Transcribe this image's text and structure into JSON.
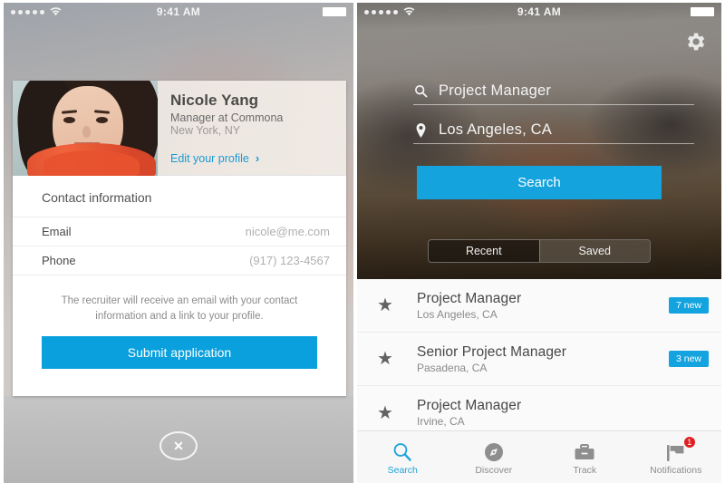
{
  "left_phone": {
    "status_bar": {
      "carrier_dots": 5,
      "wifi_icon": "wifi-icon",
      "time": "9:41 AM",
      "battery_icon": "battery-icon"
    },
    "profile": {
      "name": "Nicole Yang",
      "title": "Manager at Commona",
      "location": "New York, NY",
      "edit_link": "Edit your profile",
      "edit_chevron": "›",
      "avatar": "profile-photo"
    },
    "contact": {
      "heading": "Contact information",
      "rows": [
        {
          "label": "Email",
          "value": "nicole@me.com"
        },
        {
          "label": "Phone",
          "value": "(917) 123-4567"
        }
      ]
    },
    "disclaimer": "The recruiter will receive an email with your contact information and a link to your profile.",
    "submit_label": "Submit application",
    "close_glyph": "✕"
  },
  "right_phone": {
    "status_bar": {
      "carrier_dots": 5,
      "wifi_icon": "wifi-icon",
      "time": "9:41 AM",
      "battery_icon": "battery-icon"
    },
    "settings_icon": "gear-icon",
    "search_form": {
      "keyword": {
        "icon": "search-icon",
        "value": "Project Manager"
      },
      "location": {
        "icon": "map-pin-icon",
        "value": "Los Angeles, CA"
      },
      "submit_label": "Search"
    },
    "segmented": {
      "options": [
        "Recent",
        "Saved"
      ],
      "selected": "Saved"
    },
    "saved_searches": [
      {
        "star": "★",
        "title": "Project Manager",
        "location": "Los Angeles, CA",
        "badge": "7 new"
      },
      {
        "star": "★",
        "title": "Senior Project Manager",
        "location": "Pasadena, CA",
        "badge": "3 new"
      },
      {
        "star": "★",
        "title": "Project Manager",
        "location": "Irvine, CA",
        "badge": ""
      }
    ],
    "tabs": [
      {
        "label": "Search",
        "icon": "magnifier-icon",
        "active": true,
        "badge": ""
      },
      {
        "label": "Discover",
        "icon": "compass-icon",
        "active": false,
        "badge": ""
      },
      {
        "label": "Track",
        "icon": "briefcase-icon",
        "active": false,
        "badge": ""
      },
      {
        "label": "Notifications",
        "icon": "flag-icon",
        "active": false,
        "badge": "1"
      }
    ]
  },
  "colors": {
    "accent_blue": "#13a3de",
    "link_blue": "#1b9ad6",
    "badge_red": "#e02020"
  }
}
